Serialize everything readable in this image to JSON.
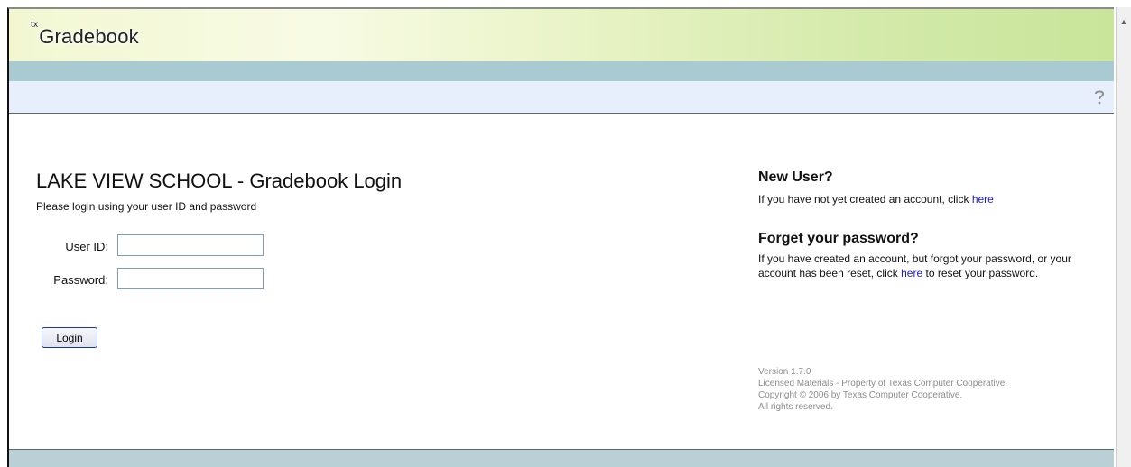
{
  "app": {
    "logo_sup": "tx",
    "logo_text": "Gradebook"
  },
  "toolbar": {
    "help_icon": "help-icon"
  },
  "login": {
    "title": "LAKE VIEW SCHOOL - Gradebook Login",
    "subtitle": "Please login using your user ID and password",
    "user_id_label": "User ID:",
    "password_label": "Password:",
    "user_id_value": "",
    "password_value": "",
    "login_button": "Login"
  },
  "new_user": {
    "heading": "New User?",
    "text": "If you have not yet created an account, click",
    "link": "here"
  },
  "forgot_password": {
    "heading": "Forget your password?",
    "text_before": "If you have created an account, but forgot your password, or your account has been reset, click",
    "link": "here",
    "text_after": "to reset your password."
  },
  "footer": {
    "version": "Version 1.7.0",
    "license": "Licensed Materials - Property of Texas Computer Cooperative.",
    "copyright": "Copyright © 2006 by Texas Computer Cooperative.",
    "rights": "All rights reserved."
  },
  "colors": {
    "link": "#1a1ae0",
    "header_gradient_left": "#f2f7d2",
    "header_gradient_right": "#c8e59a",
    "teal_bar": "#a8cad0",
    "tool_bar": "#e8effc"
  }
}
